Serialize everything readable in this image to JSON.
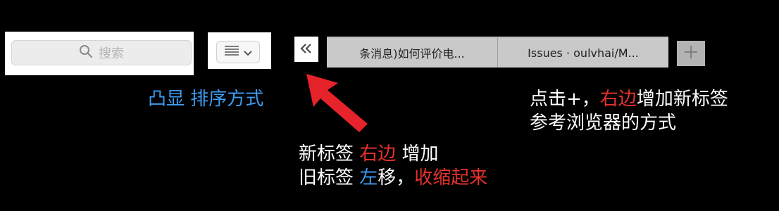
{
  "search": {
    "placeholder": "搜索"
  },
  "tabs": [
    {
      "label": "条消息)如何评价电..."
    },
    {
      "label": "Issues · oulvhai/M..."
    }
  ],
  "annotations": {
    "sort_note": {
      "part1": "凸显",
      "part2": "排序方式"
    },
    "add_note": {
      "line1_a": "点击+，",
      "line1_b": "右边",
      "line1_c": "增加新标签",
      "line2": "参考浏览器的方式"
    },
    "collapse_note": {
      "line1_a": "新标签 ",
      "line1_b": "右边",
      "line1_c": " 增加",
      "line2_a": "旧标签 ",
      "line2_b": "左",
      "line2_c": "移，",
      "line2_d": "收缩起来"
    }
  },
  "colors": {
    "accent_blue": "#3d9cf2",
    "accent_red": "#e6322c",
    "arrow": "#e6222a"
  },
  "icons": {
    "search": "search-icon",
    "sort": "list-icon",
    "dropdown": "chevron-down-icon",
    "collapse": "double-chevron-left-icon",
    "add": "plus-icon"
  }
}
